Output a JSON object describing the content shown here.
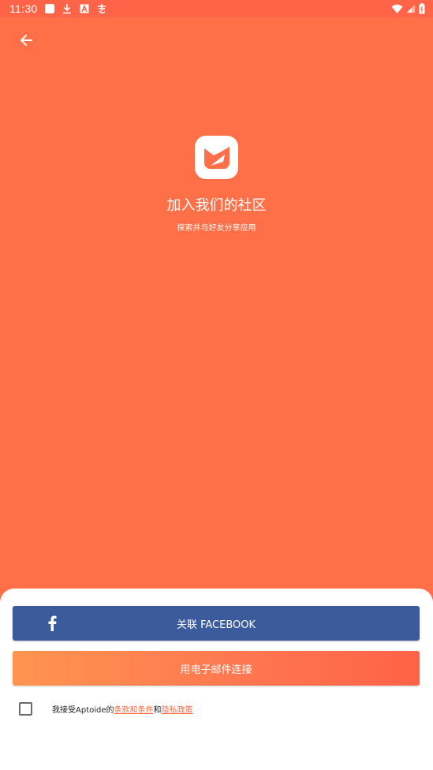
{
  "status_bar": {
    "time": "11:30",
    "left_icons": [
      "app-square-icon",
      "download-icon",
      "font-a-icon",
      "app-glyph-icon"
    ],
    "right_icons": [
      "wifi-icon",
      "signal-icon",
      "battery-icon"
    ]
  },
  "header": {
    "back_icon": "arrow-back-icon"
  },
  "hero": {
    "logo_icon": "aptoide-logo-icon",
    "title": "加入我们的社区",
    "subtitle": "探索并与好友分享应用"
  },
  "actions": {
    "facebook_label": "关联 FACEBOOK",
    "facebook_icon": "facebook-f-icon",
    "email_label": "用电子邮件连接"
  },
  "terms": {
    "prefix": "我接受Aptoide的",
    "terms_link": "条款和条件",
    "joiner": "和",
    "privacy_link": "隐私政策",
    "checked": false
  },
  "colors": {
    "background": "#ff6f48",
    "status_bar": "#ff6448",
    "facebook": "#3c5b9c",
    "email_gradient_start": "#ff9450",
    "email_gradient_end": "#ff6248",
    "link": "#ff6a40"
  }
}
